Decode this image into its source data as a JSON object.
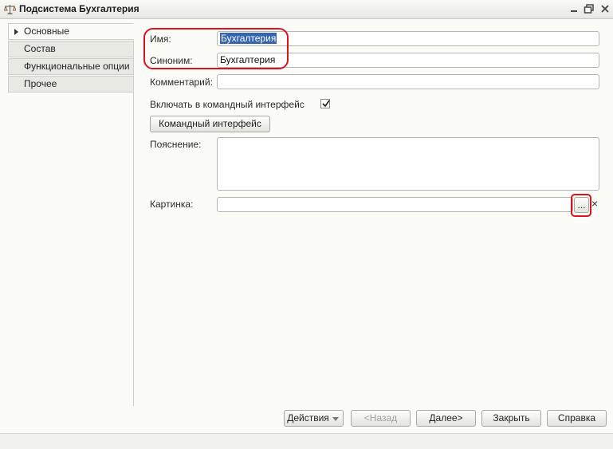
{
  "window": {
    "title": "Подсистема Бухгалтерия"
  },
  "tabs": [
    {
      "label": "Основные",
      "active": true
    },
    {
      "label": "Состав"
    },
    {
      "label": "Функциональные опции"
    },
    {
      "label": "Прочее"
    }
  ],
  "form": {
    "name_label": "Имя:",
    "name_value": "Бухгалтерия",
    "synonym_label": "Синоним:",
    "synonym_value": "Бухгалтерия",
    "comment_label": "Комментарий:",
    "comment_value": "",
    "include_label": "Включать в командный интерфейс",
    "include_checked": true,
    "command_interface_button": "Командный интерфейс",
    "explanation_label": "Пояснение:",
    "explanation_value": "",
    "picture_label": "Картинка:",
    "picture_value": "",
    "picture_select_button": "...",
    "picture_clear_button": "×"
  },
  "footer": {
    "actions": "Действия",
    "back": "<Назад",
    "next": "Далее>",
    "close": "Закрыть",
    "help": "Справка"
  },
  "colors": {
    "highlight": "#d8131e",
    "selection": "#3465b0"
  }
}
